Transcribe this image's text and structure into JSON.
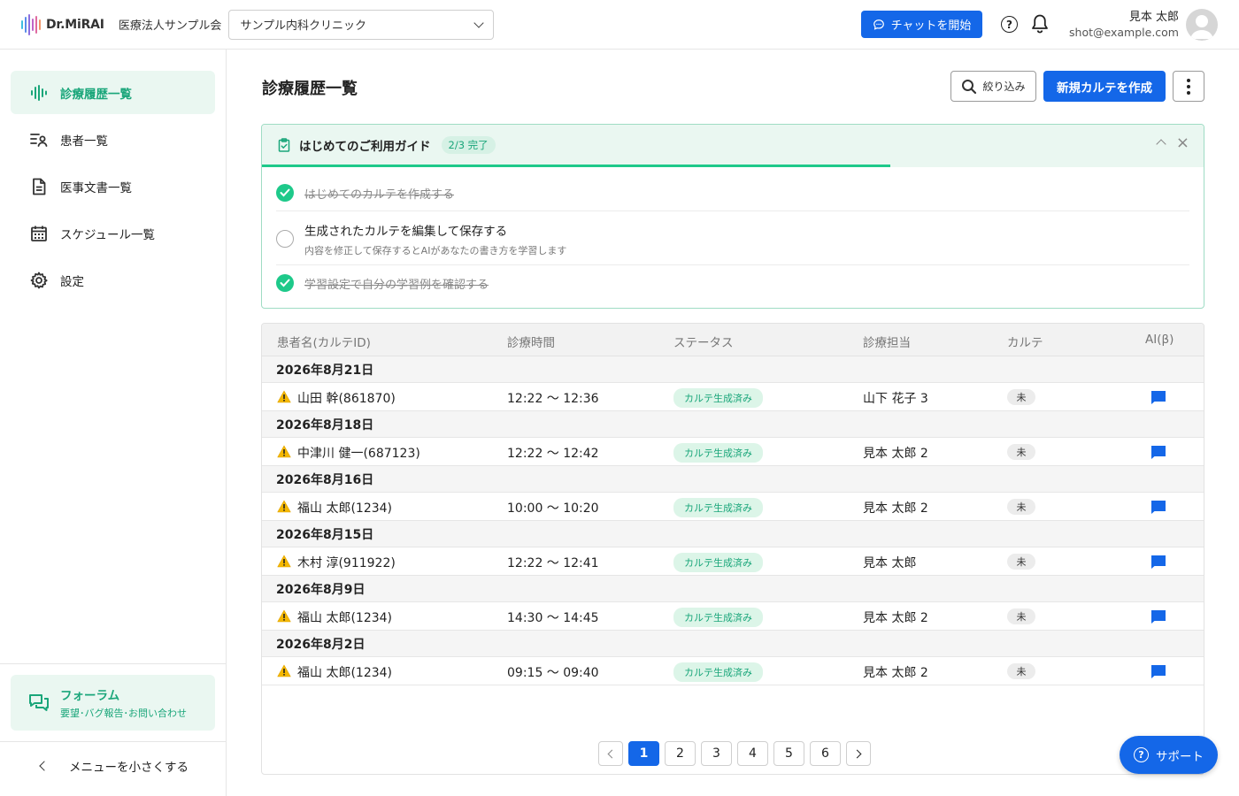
{
  "header": {
    "logo_text": "Dr.MiRAI",
    "org_name": "医療法人サンプル会",
    "clinic_selected": "サンプル内科クリニック",
    "chat_label": "チャットを開始",
    "help_glyph": "?",
    "user_name": "見本 太郎",
    "user_email": "shot@example.com"
  },
  "sidebar": {
    "items": [
      {
        "label": "診療履歴一覧",
        "icon": "waveform-icon",
        "active": true
      },
      {
        "label": "患者一覧",
        "icon": "patient-list-icon",
        "active": false
      },
      {
        "label": "医事文書一覧",
        "icon": "document-icon",
        "active": false
      },
      {
        "label": "スケジュール一覧",
        "icon": "calendar-icon",
        "active": false
      },
      {
        "label": "設定",
        "icon": "gear-icon",
        "active": false
      }
    ],
    "forum_title": "フォーラム",
    "forum_sub": "要望･バグ報告･お問い合わせ",
    "collapse_label": "メニューを小さくする"
  },
  "main": {
    "title": "診療履歴一覧",
    "filter_label": "絞り込み",
    "new_label": "新規カルテを作成"
  },
  "guide": {
    "title": "はじめてのご利用ガイド",
    "badge": "2/3 完了",
    "progress": 0.667,
    "close_glyph": "×",
    "steps": [
      {
        "text": "はじめてのカルテを作成する",
        "done": true
      },
      {
        "text": "生成されたカルテを編集して保存する",
        "sub": "内容を修正して保存するとAIがあなたの書き方を学習します",
        "done": false
      },
      {
        "text": "学習設定で自分の学習例を確認する",
        "done": true
      }
    ]
  },
  "table": {
    "headers": [
      "患者名(カルテID)",
      "診療時間",
      "ステータス",
      "診療担当",
      "カルテ",
      "AI(β)"
    ],
    "groups": [
      {
        "date": "2026年8月21日",
        "rows": [
          {
            "patient": "山田 幹(861870)",
            "time": "12:22 ～ 12:36",
            "status": "カルテ生成済み",
            "doctor": "山下 花子 3",
            "karte": "未"
          }
        ]
      },
      {
        "date": "2026年8月18日",
        "rows": [
          {
            "patient": "中津川 健一(687123)",
            "time": "12:22 ～ 12:42",
            "status": "カルテ生成済み",
            "doctor": "見本 太郎 2",
            "karte": "未"
          }
        ]
      },
      {
        "date": "2026年8月16日",
        "rows": [
          {
            "patient": "福山 太郎(1234)",
            "time": "10:00 ～ 10:20",
            "status": "カルテ生成済み",
            "doctor": "見本 太郎 2",
            "karte": "未"
          }
        ]
      },
      {
        "date": "2026年8月15日",
        "rows": [
          {
            "patient": "木村 淳(911922)",
            "time": "12:22 ～ 12:41",
            "status": "カルテ生成済み",
            "doctor": "見本 太郎",
            "karte": "未"
          }
        ]
      },
      {
        "date": "2026年8月9日",
        "rows": [
          {
            "patient": "福山 太郎(1234)",
            "time": "14:30 ～ 14:45",
            "status": "カルテ生成済み",
            "doctor": "見本 太郎 2",
            "karte": "未"
          }
        ]
      },
      {
        "date": "2026年8月2日",
        "rows": [
          {
            "patient": "福山 太郎(1234)",
            "time": "09:15 ～ 09:40",
            "status": "カルテ生成済み",
            "doctor": "見本 太郎 2",
            "karte": "未"
          }
        ]
      }
    ]
  },
  "pagination": {
    "pages": [
      "1",
      "2",
      "3",
      "4",
      "5",
      "6"
    ],
    "current": "1"
  },
  "support_label": "サポート",
  "colors": {
    "primary": "#1467e8",
    "accent": "#1aa67a",
    "accent_bg": "#eaf7f1",
    "progress": "#1ec98a"
  }
}
